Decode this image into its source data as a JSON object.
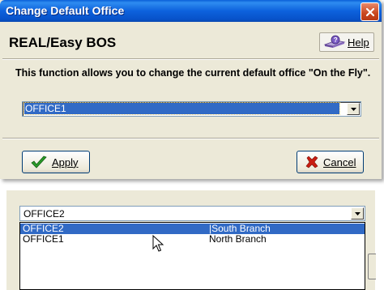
{
  "window": {
    "title": "Change Default Office"
  },
  "header": {
    "app_name": "REAL/Easy BOS",
    "help_label": "Help"
  },
  "description": "This function allows you to change the current default office \"On the Fly\".",
  "office_select": {
    "selected": "OFFICE1"
  },
  "buttons": {
    "apply": "Apply",
    "cancel": "Cancel"
  },
  "expanded_select": {
    "value": "OFFICE2",
    "options": [
      {
        "code": "OFFICE2",
        "branch": "|South Branch",
        "selected": true
      },
      {
        "code": "OFFICE1",
        "branch": "North Branch",
        "selected": false
      }
    ]
  },
  "colors": {
    "title_bar": "#0a5fd8",
    "selection": "#316ac5",
    "close_button": "#c9471f",
    "dialog_bg": "#ece9d8"
  },
  "icons": [
    "close-icon",
    "help-icon",
    "checkmark-icon",
    "x-icon",
    "chevron-down-icon",
    "mouse-pointer-icon"
  ]
}
